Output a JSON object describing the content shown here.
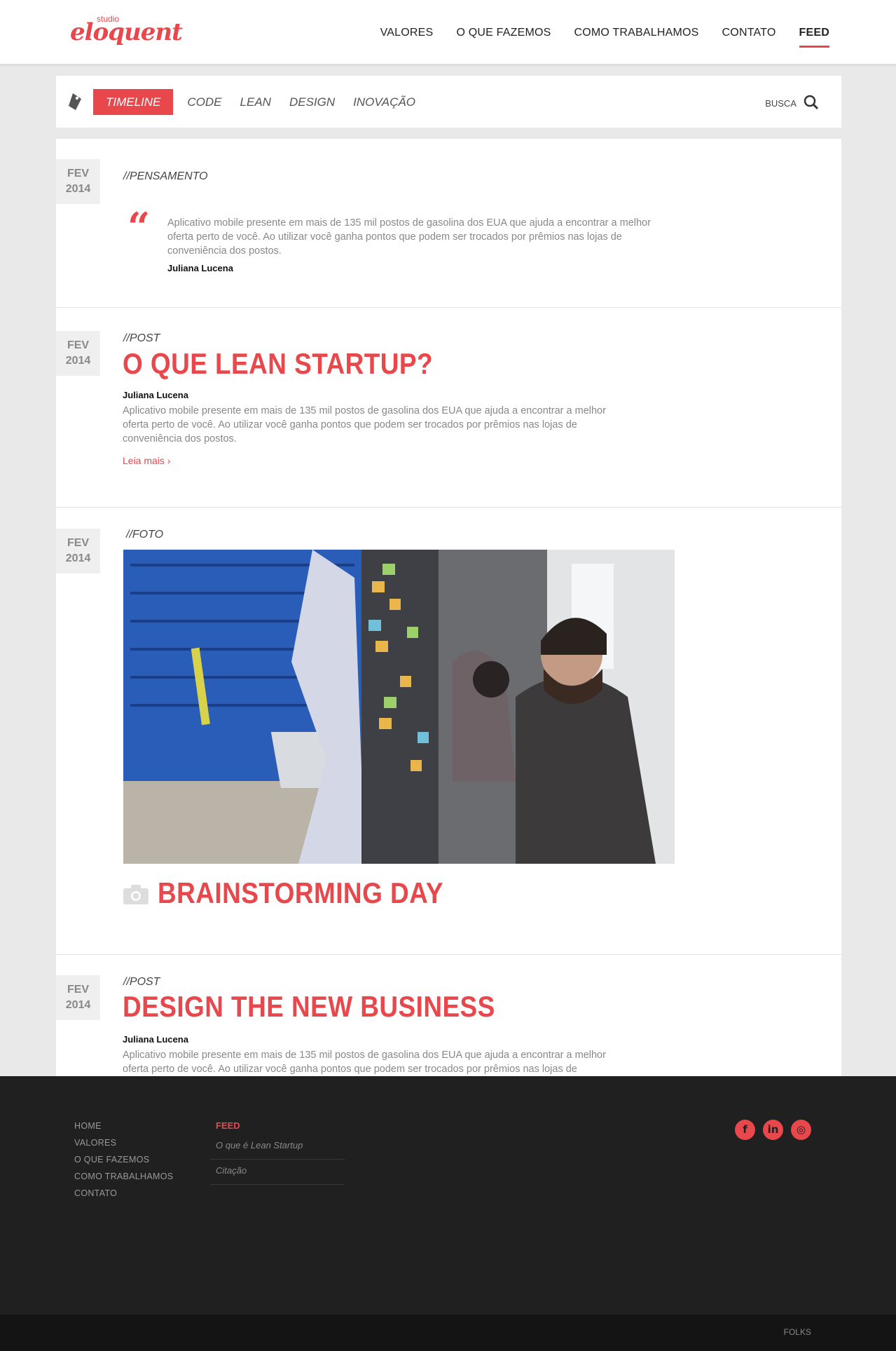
{
  "header": {
    "logo_small": "studio",
    "logo_word": "eloquent",
    "nav": [
      "VALORES",
      "O QUE FAZEMOS",
      "COMO TRABALHAMOS",
      "CONTATO",
      "FEED"
    ]
  },
  "filter": {
    "tabs": [
      "TIMELINE",
      "CODE",
      "LEAN",
      "DESIGN",
      "INOVAÇÃO"
    ],
    "search_label": "BUSCA"
  },
  "entries": [
    {
      "month": "FEV",
      "year": "2014",
      "kind": "//PENSAMENTO",
      "quote_mark": "“",
      "text": "Aplicativo mobile presente em mais de 135 mil postos de gasolina dos EUA que ajuda a encontrar a melhor oferta perto de você. Ao utilizar você ganha pontos que podem ser trocados por prêmios nas lojas de conveniência dos postos.",
      "author": "Juliana Lucena"
    },
    {
      "month": "FEV",
      "year": "2014",
      "kind": "//POST",
      "title": "O QUE LEAN STARTUP?",
      "author": "Juliana Lucena",
      "text": "Aplicativo mobile presente em mais de 135 mil postos de gasolina dos EUA que ajuda a encontrar a melhor oferta perto de você. Ao utilizar você ganha pontos que podem ser trocados por prêmios nas lojas de conveniência dos postos.",
      "more": "Leia mais ›"
    },
    {
      "month": "FEV",
      "year": "2014",
      "kind": "//FOTO",
      "title": "BRAINSTORMING DAY"
    },
    {
      "month": "FEV",
      "year": "2014",
      "kind": "//POST",
      "title": "DESIGN THE NEW BUSINESS",
      "author": "Juliana Lucena",
      "text": "Aplicativo mobile presente em mais de 135 mil postos de gasolina dos EUA que ajuda a encontrar a melhor oferta perto de você. Ao utilizar você ganha pontos que podem ser trocados por prêmios nas lojas de conveniência dos postos."
    }
  ],
  "footer": {
    "links": [
      "HOME",
      "VALORES",
      "O QUE FAZEMOS",
      "COMO TRABALHAMOS",
      "CONTATO"
    ],
    "feed_heading": "FEED",
    "feed_items": [
      "O que é Lean Startup",
      "Citação"
    ],
    "social": [
      {
        "icon": "facebook-icon",
        "glyph": "f"
      },
      {
        "icon": "linkedin-icon",
        "glyph": "in"
      },
      {
        "icon": "instagram-icon",
        "glyph": "◎"
      }
    ],
    "bottom_label": "FOLKS"
  },
  "colors": {
    "accent": "#e8474b",
    "footer_bg": "#202020",
    "bottom_bg": "#141414"
  }
}
